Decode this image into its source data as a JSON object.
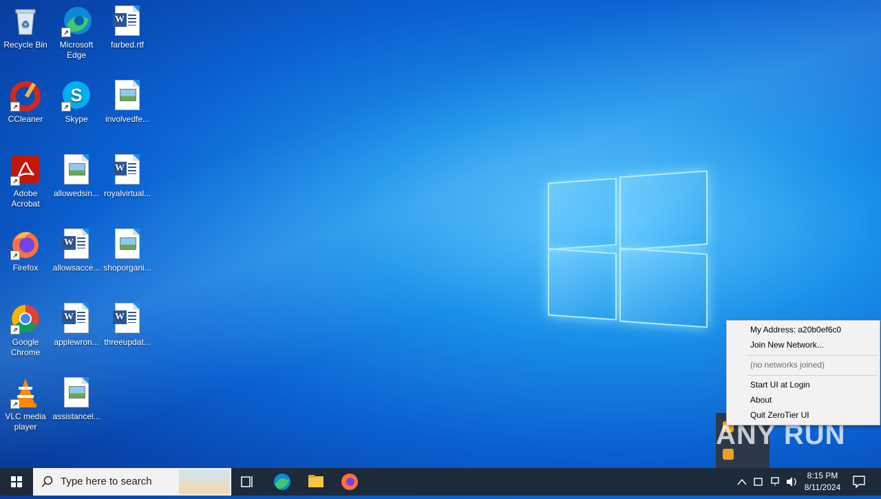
{
  "desktop": {
    "icons": [
      {
        "label": "Recycle Bin"
      },
      {
        "label": "Microsoft Edge"
      },
      {
        "label": "farbed.rtf"
      },
      {
        "label": "CCleaner"
      },
      {
        "label": "Skype"
      },
      {
        "label": "involvedfe..."
      },
      {
        "label": "Adobe Acrobat"
      },
      {
        "label": "allowedsin..."
      },
      {
        "label": "royalvirtual..."
      },
      {
        "label": "Firefox"
      },
      {
        "label": "allowsacce..."
      },
      {
        "label": "shoporgani..."
      },
      {
        "label": "Google Chrome"
      },
      {
        "label": "applewron..."
      },
      {
        "label": "threeupdat..."
      },
      {
        "label": "VLC media player"
      },
      {
        "label": "assistancel..."
      }
    ]
  },
  "context_menu": {
    "my_address": "My Address:  a20b0ef6c0",
    "join_new_network": "Join New Network...",
    "no_networks": "(no networks joined)",
    "start_ui_at_login": "Start UI at Login",
    "about": "About",
    "quit": "Quit ZeroTier UI"
  },
  "taskbar": {
    "search_placeholder": "Type here to search",
    "time": "8:15 PM",
    "date": "8/11/2024"
  },
  "watermark": "ANY RUN",
  "colors": {
    "taskbar": "#1c2a3a",
    "menu_bg": "#f2f2f2",
    "accent": "#0078d7"
  }
}
